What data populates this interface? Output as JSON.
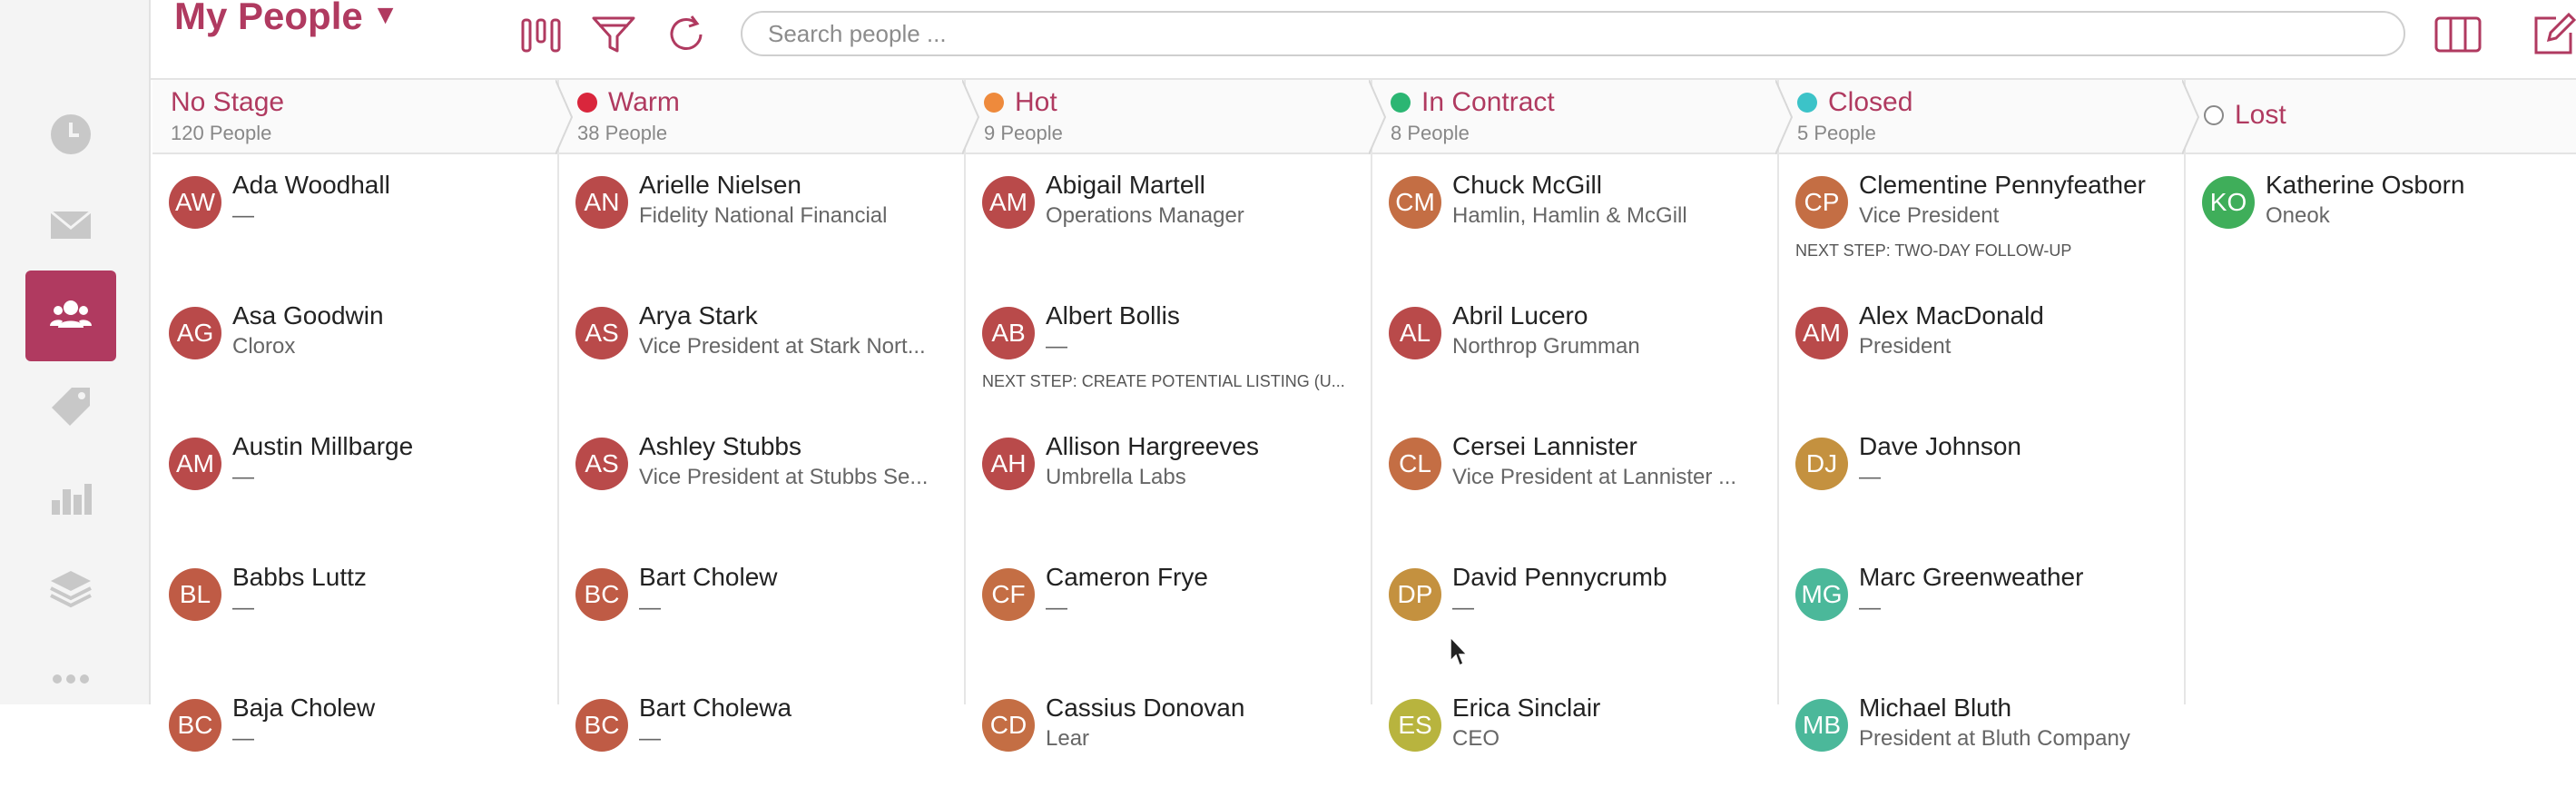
{
  "header": {
    "title": "My People",
    "caret": "▼",
    "search_placeholder": "Search people ..."
  },
  "colors": {
    "accent": "#b03a60",
    "warm": "#d9263c",
    "hot": "#ee8a3c",
    "in_contract": "#2bb673",
    "closed": "#3cc3c8"
  },
  "sidebar": {
    "items": [
      {
        "icon": "clock-icon"
      },
      {
        "icon": "envelope-icon"
      },
      {
        "icon": "people-icon",
        "active": true
      },
      {
        "icon": "tag-icon"
      },
      {
        "icon": "bar-chart-icon"
      },
      {
        "icon": "layers-icon"
      },
      {
        "icon": "more-icon"
      }
    ]
  },
  "columns": [
    {
      "title": "No Stage",
      "count": "120 People",
      "dot": "",
      "cards": [
        {
          "initials": "AW",
          "color": "#b94a4a",
          "name": "Ada Woodhall",
          "sub": "—",
          "next": ""
        },
        {
          "initials": "AG",
          "color": "#b94a4a",
          "name": "Asa Goodwin",
          "sub": "Clorox",
          "next": ""
        },
        {
          "initials": "AM",
          "color": "#b94a4a",
          "name": "Austin Millbarge",
          "sub": "—",
          "next": ""
        },
        {
          "initials": "BL",
          "color": "#bf5b45",
          "name": "Babbs Luttz",
          "sub": "—",
          "next": ""
        },
        {
          "initials": "BC",
          "color": "#bf5b45",
          "name": "Baja Cholew",
          "sub": "—",
          "next": ""
        }
      ]
    },
    {
      "title": "Warm",
      "count": "38 People",
      "dot": "warm",
      "cards": [
        {
          "initials": "AN",
          "color": "#b94a4a",
          "name": "Arielle Nielsen",
          "sub": "Fidelity National Financial",
          "next": ""
        },
        {
          "initials": "AS",
          "color": "#b94a4a",
          "name": "Arya Stark",
          "sub": "Vice President at Stark Nort...",
          "next": ""
        },
        {
          "initials": "AS",
          "color": "#b94a4a",
          "name": "Ashley Stubbs",
          "sub": "Vice President at Stubbs Se...",
          "next": ""
        },
        {
          "initials": "BC",
          "color": "#bf5b45",
          "name": "Bart Cholew",
          "sub": "—",
          "next": ""
        },
        {
          "initials": "BC",
          "color": "#bf5b45",
          "name": "Bart Cholewa",
          "sub": "—",
          "next": ""
        }
      ]
    },
    {
      "title": "Hot",
      "count": "9 People",
      "dot": "hot",
      "cards": [
        {
          "initials": "AM",
          "color": "#b94a4a",
          "name": "Abigail Martell",
          "sub": "Operations Manager",
          "next": ""
        },
        {
          "initials": "AB",
          "color": "#b94a4a",
          "name": "Albert Bollis",
          "sub": "—",
          "next": "NEXT STEP: CREATE POTENTIAL LISTING (U..."
        },
        {
          "initials": "AH",
          "color": "#b94a4a",
          "name": "Allison Hargreeves",
          "sub": "Umbrella Labs",
          "next": ""
        },
        {
          "initials": "CF",
          "color": "#c46e44",
          "name": "Cameron Frye",
          "sub": "—",
          "next": ""
        },
        {
          "initials": "CD",
          "color": "#c46e44",
          "name": "Cassius Donovan",
          "sub": "Lear",
          "next": ""
        }
      ]
    },
    {
      "title": "In Contract",
      "count": "8 People",
      "dot": "in_contract",
      "cards": [
        {
          "initials": "CM",
          "color": "#c46e44",
          "name": "Chuck McGill",
          "sub": "Hamlin, Hamlin & McGill",
          "next": ""
        },
        {
          "initials": "AL",
          "color": "#b94a4a",
          "name": "Abril Lucero",
          "sub": "Northrop Grumman",
          "next": ""
        },
        {
          "initials": "CL",
          "color": "#c46e44",
          "name": "Cersei Lannister",
          "sub": "Vice President at Lannister ...",
          "next": ""
        },
        {
          "initials": "DP",
          "color": "#c4913f",
          "name": "David Pennycrumb",
          "sub": "—",
          "next": ""
        },
        {
          "initials": "ES",
          "color": "#b8b43e",
          "name": "Erica Sinclair",
          "sub": "CEO",
          "next": ""
        }
      ]
    },
    {
      "title": "Closed",
      "count": "5 People",
      "dot": "closed",
      "cards": [
        {
          "initials": "CP",
          "color": "#c46e44",
          "name": "Clementine Pennyfeather",
          "sub": "Vice President",
          "next": "NEXT STEP: TWO-DAY FOLLOW-UP"
        },
        {
          "initials": "AM",
          "color": "#b94a4a",
          "name": "Alex MacDonald",
          "sub": "President",
          "next": ""
        },
        {
          "initials": "DJ",
          "color": "#c4913f",
          "name": "Dave Johnson",
          "sub": "—",
          "next": ""
        },
        {
          "initials": "MG",
          "color": "#4bb89a",
          "name": "Marc Greenweather",
          "sub": "—",
          "next": ""
        },
        {
          "initials": "MB",
          "color": "#4bb89a",
          "name": "Michael Bluth",
          "sub": "President at Bluth Company",
          "next": ""
        }
      ]
    },
    {
      "title": "Lost",
      "count": "",
      "dot": "lost",
      "cards": [
        {
          "initials": "KO",
          "color": "#3fae5a",
          "name": "Katherine Osborn",
          "sub": "Oneok",
          "next": ""
        }
      ]
    }
  ]
}
